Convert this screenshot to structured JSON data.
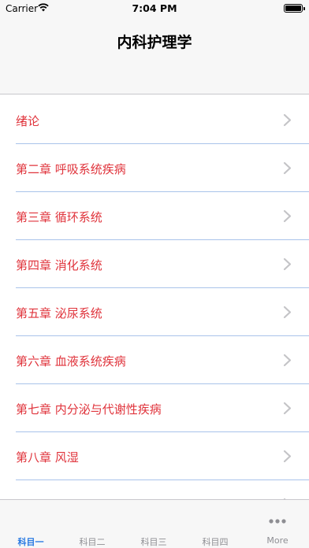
{
  "status_bar": {
    "carrier": "Carrier",
    "time": "7:04 PM"
  },
  "header": {
    "title": "内科护理学"
  },
  "list": {
    "items": [
      {
        "label": "绪论"
      },
      {
        "label": "第二章 呼吸系统疾病"
      },
      {
        "label": "第三章 循环系统"
      },
      {
        "label": "第四章 消化系统"
      },
      {
        "label": "第五章 泌尿系统"
      },
      {
        "label": "第六章 血液系统疾病"
      },
      {
        "label": "第七章 内分泌与代谢性疾病"
      },
      {
        "label": "第八章 风湿"
      }
    ]
  },
  "tab_bar": {
    "tabs": [
      {
        "label": "科目一"
      },
      {
        "label": "科目二"
      },
      {
        "label": "科目三"
      },
      {
        "label": "科目四"
      },
      {
        "label": "More"
      }
    ]
  },
  "colors": {
    "item_text": "#e0343c",
    "divider": "#a9c3ea",
    "tab_active": "#2a7ae2",
    "tab_inactive": "#8e8e93"
  }
}
